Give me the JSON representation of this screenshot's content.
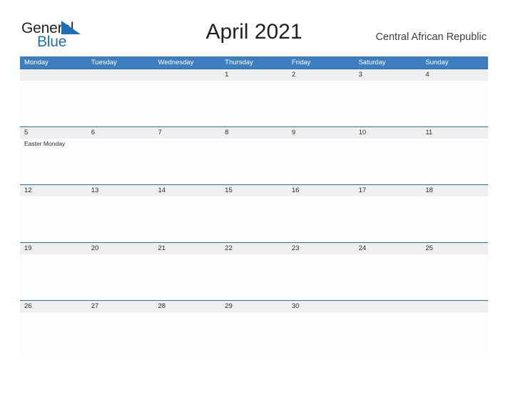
{
  "brand": {
    "name_part1": "General",
    "name_part2": "Blue",
    "flag_icon": "blue-triangle-flag-icon",
    "primary_color": "#1f6fb5",
    "header_color": "#3c7ebf",
    "row_divider_color": "#2e6ca4",
    "band_color": "#efefef"
  },
  "header": {
    "title": "April 2021",
    "country": "Central African Republic"
  },
  "calendar": {
    "weekday_headers": [
      "Monday",
      "Tuesday",
      "Wednesday",
      "Thursday",
      "Friday",
      "Saturday",
      "Sunday"
    ],
    "weeks": [
      [
        {
          "date": "",
          "events": []
        },
        {
          "date": "",
          "events": []
        },
        {
          "date": "",
          "events": []
        },
        {
          "date": "1",
          "events": []
        },
        {
          "date": "2",
          "events": []
        },
        {
          "date": "3",
          "events": []
        },
        {
          "date": "4",
          "events": []
        }
      ],
      [
        {
          "date": "5",
          "events": [
            "Easter Monday"
          ]
        },
        {
          "date": "6",
          "events": []
        },
        {
          "date": "7",
          "events": []
        },
        {
          "date": "8",
          "events": []
        },
        {
          "date": "9",
          "events": []
        },
        {
          "date": "10",
          "events": []
        },
        {
          "date": "11",
          "events": []
        }
      ],
      [
        {
          "date": "12",
          "events": []
        },
        {
          "date": "13",
          "events": []
        },
        {
          "date": "14",
          "events": []
        },
        {
          "date": "15",
          "events": []
        },
        {
          "date": "16",
          "events": []
        },
        {
          "date": "17",
          "events": []
        },
        {
          "date": "18",
          "events": []
        }
      ],
      [
        {
          "date": "19",
          "events": []
        },
        {
          "date": "20",
          "events": []
        },
        {
          "date": "21",
          "events": []
        },
        {
          "date": "22",
          "events": []
        },
        {
          "date": "23",
          "events": []
        },
        {
          "date": "24",
          "events": []
        },
        {
          "date": "25",
          "events": []
        }
      ],
      [
        {
          "date": "26",
          "events": []
        },
        {
          "date": "27",
          "events": []
        },
        {
          "date": "28",
          "events": []
        },
        {
          "date": "29",
          "events": []
        },
        {
          "date": "30",
          "events": []
        },
        {
          "date": "",
          "events": []
        },
        {
          "date": "",
          "events": []
        }
      ]
    ]
  }
}
